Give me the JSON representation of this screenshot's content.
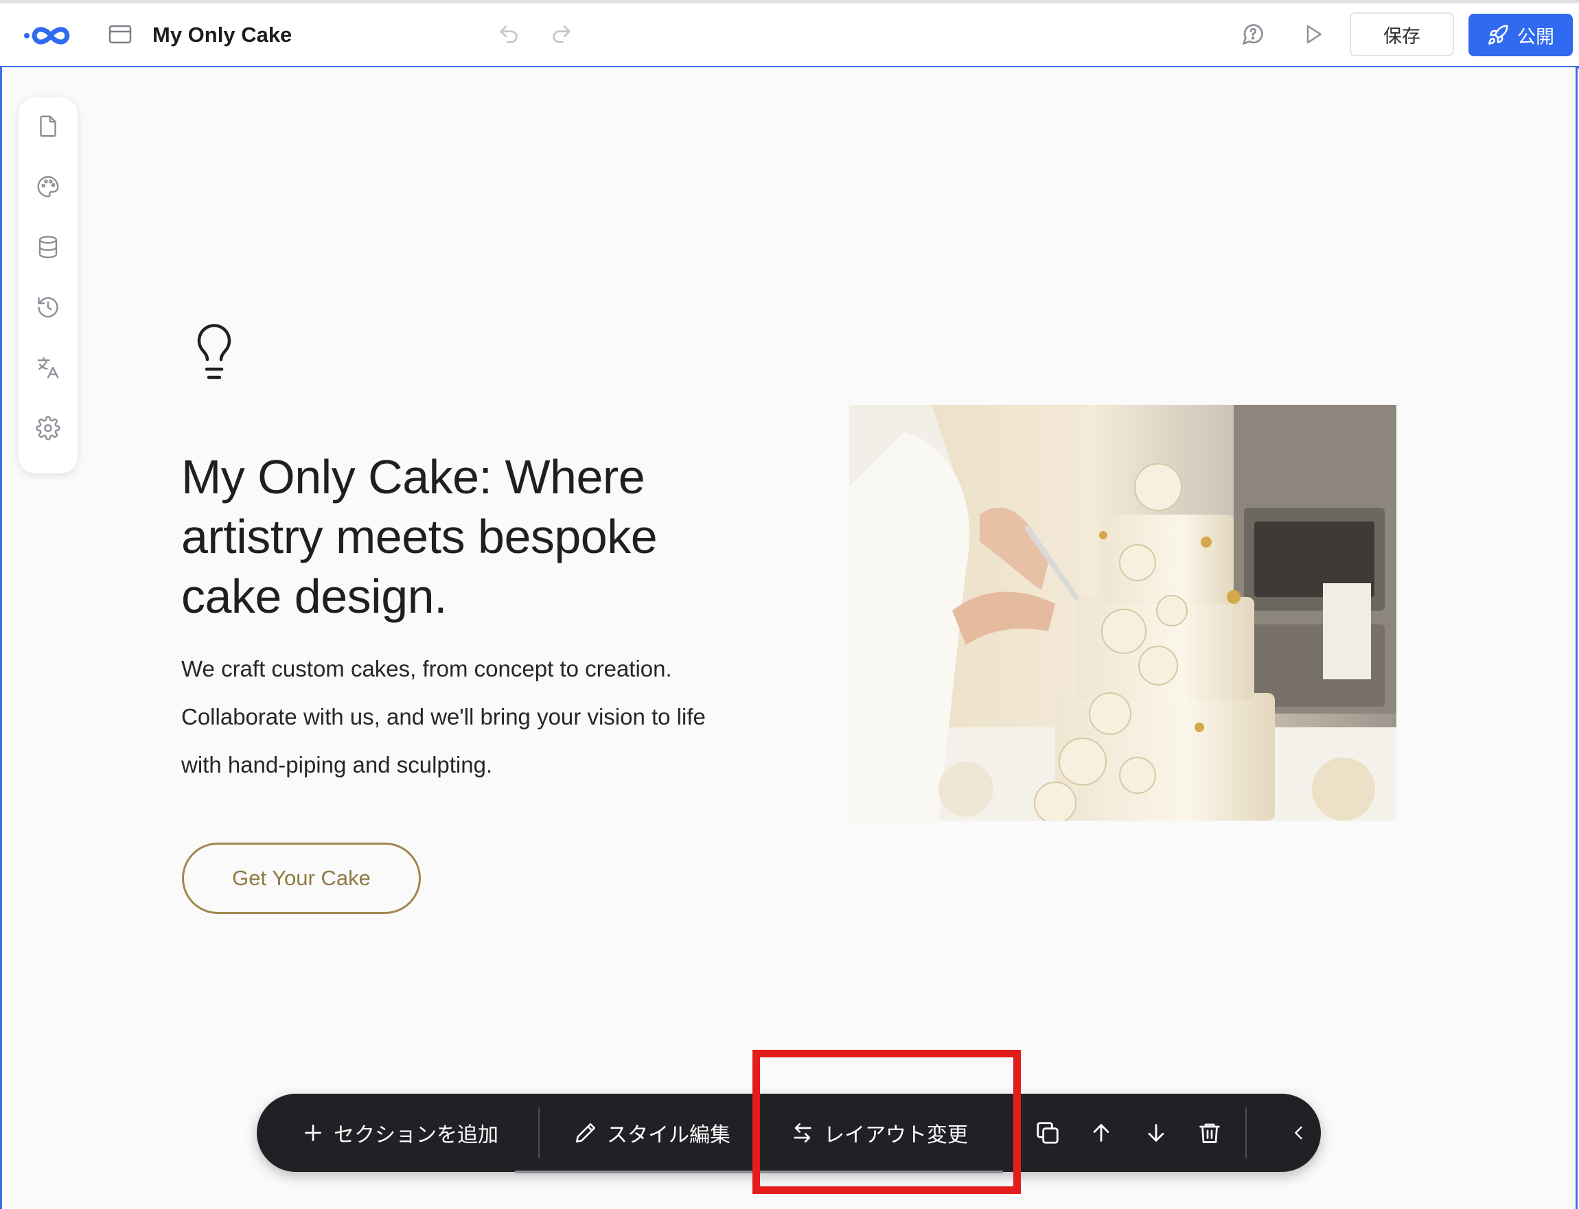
{
  "header": {
    "title": "My Only Cake",
    "save_label": "保存",
    "publish_label": "公開",
    "brand_color": "#2f6af0",
    "icons": [
      "logo-icon",
      "page-icon",
      "undo-icon",
      "redo-icon",
      "chat-help-icon",
      "play-icon",
      "rocket-icon"
    ]
  },
  "sidebar": {
    "items": [
      {
        "name": "pages",
        "icon": "file-icon"
      },
      {
        "name": "theme",
        "icon": "palette-icon"
      },
      {
        "name": "data",
        "icon": "database-icon"
      },
      {
        "name": "history",
        "icon": "history-icon"
      },
      {
        "name": "translate",
        "icon": "translate-icon"
      },
      {
        "name": "settings",
        "icon": "gear-icon"
      }
    ]
  },
  "hero": {
    "title": "My Only Cake: Where artistry meets bespoke cake design.",
    "body": "We craft custom cakes, from concept to creation. Collaborate with us, and we'll bring your vision to life with hand-piping and sculpting.",
    "cta_label": "Get Your Cake",
    "accent_color": "#a08850",
    "image_subject": "baker decorating a tiered white floral cake"
  },
  "toolbar": {
    "add_section_label": "セクションを追加",
    "edit_style_label": "スタイル編集",
    "change_layout_label": "レイアウト変更",
    "icons": [
      "plus-icon",
      "pencil-icon",
      "swap-icon",
      "duplicate-icon",
      "arrow-up-icon",
      "arrow-down-icon",
      "trash-icon",
      "chevron-left-icon"
    ]
  },
  "annotation": {
    "highlight_color": "#e31c1c",
    "target": "change-layout-button"
  }
}
